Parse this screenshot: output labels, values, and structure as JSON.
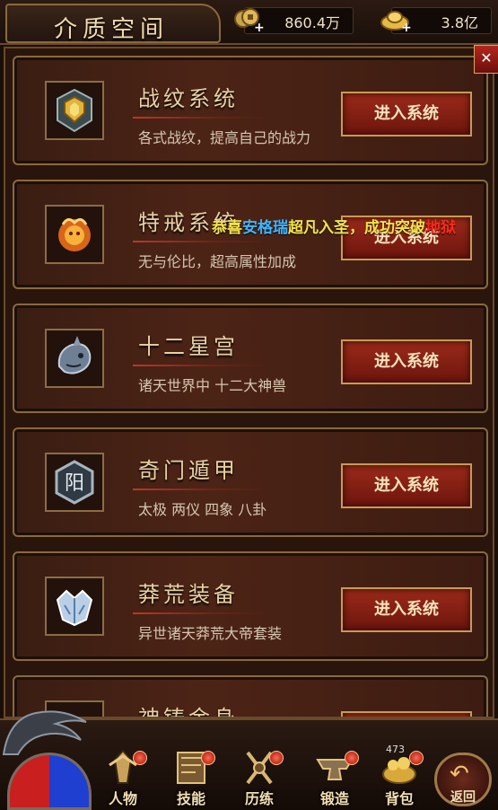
{
  "header": {
    "title": "介质空间",
    "copper": "860.4万",
    "gold": "3.8亿",
    "copper_icon": "coins-icon",
    "gold_icon": "gold-ingot-icon"
  },
  "enter_label": "进入系统",
  "systems": [
    {
      "title": "战纹系统",
      "desc": "各式战纹，提高自己的战力",
      "icon": "shield-emblem-icon"
    },
    {
      "title": "特戒系统",
      "desc": "无与伦比，超高属性加成",
      "icon": "fire-beast-icon"
    },
    {
      "title": "十二星宫",
      "desc": "诸天世界中 十二大神兽",
      "icon": "dragon-head-icon"
    },
    {
      "title": "奇门遁甲",
      "desc": "太极 两仪 四象 八卦",
      "icon": "yang-hexagon-icon"
    },
    {
      "title": "莽荒装备",
      "desc": "异世诸天莽荒大帝套装",
      "icon": "armor-icon"
    },
    {
      "title": "神铸金身",
      "desc": "",
      "icon": "golden-body-icon"
    }
  ],
  "broadcast": [
    {
      "text": "恭喜",
      "color": "#f5e34b"
    },
    {
      "text": "安格瑞",
      "color": "#3fb6ff"
    },
    {
      "text": "超凡入圣，",
      "color": "#f5e34b"
    },
    {
      "text": "成功突破",
      "color": "#f5e34b"
    },
    {
      "text": "地狱",
      "color": "#ff2a1a"
    }
  ],
  "bottom_nav": [
    {
      "label": "人物",
      "icon": "character-icon"
    },
    {
      "label": "技能",
      "icon": "skill-book-icon"
    },
    {
      "label": "历练",
      "icon": "training-icon"
    },
    {
      "label": "锻造",
      "icon": "anvil-icon"
    },
    {
      "label": "背包",
      "icon": "treasure-bag-icon"
    }
  ],
  "bag_count": "473",
  "back_label": "返回",
  "colors": {
    "accent_red": "#9b2a1a",
    "gold_border": "#c99a55",
    "panel_bg": "#2a150d"
  }
}
